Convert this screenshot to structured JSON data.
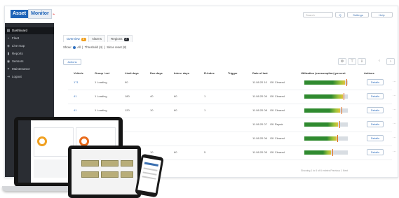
{
  "app": {
    "logo_part1": "Asset",
    "logo_part2": "Monitor",
    "search_placeholder": "Search",
    "top_buttons": [
      "Q",
      "Settings",
      "Help"
    ]
  },
  "sidebar": {
    "items": [
      {
        "label": "Dashboard",
        "icon": "grid-icon"
      },
      {
        "label": "Fleet",
        "icon": "truck-icon"
      },
      {
        "label": "Live map",
        "icon": "map-icon"
      },
      {
        "label": "Reports",
        "icon": "chart-icon"
      },
      {
        "label": "Sensors",
        "icon": "sensor-icon"
      },
      {
        "label": "Maintenance",
        "icon": "wrench-icon"
      },
      {
        "label": "Logout",
        "icon": "logout-icon"
      }
    ]
  },
  "tabs": [
    {
      "label": "Overview",
      "badge": "6",
      "badge_color": "#f0a020"
    },
    {
      "label": "Alarms",
      "badge": "",
      "badge_color": ""
    },
    {
      "label": "Regions",
      "badge": "2",
      "badge_color": "#2a2d33"
    }
  ],
  "filters": {
    "show_label": "Show:",
    "all_label": "All",
    "threshold_label": "Threshold (4)",
    "since_label": "Since reset (8)"
  },
  "toolbar": {
    "left_button": "Actions"
  },
  "table": {
    "columns": [
      "Vehicle",
      "Group / ext",
      "Limit days",
      "Due days",
      "Interv. days",
      "R-Index",
      "Trigger",
      "Date of last",
      "Utilization (consumption) percent",
      "Actions"
    ],
    "rows": [
      {
        "vehicle": "171",
        "group": "1 Loading",
        "limit": "90",
        "due": "",
        "interval": "",
        "rindex": "",
        "date": "11.08.20 10",
        "status": "OK Cleared",
        "fill": 0.93,
        "marker": 0.96,
        "action": "Details"
      },
      {
        "vehicle": "41",
        "group": "1 Loading",
        "limit": "180",
        "due": "40",
        "interval": "60",
        "rindex": "1",
        "date": "11.08.20 09",
        "status": "OK Cleared",
        "fill": 0.88,
        "marker": 0.9,
        "action": "Details"
      },
      {
        "vehicle": "41",
        "group": "1 Loading",
        "limit": "120",
        "due": "10",
        "interval": "60",
        "rindex": "1",
        "date": "11.08.20 08",
        "status": "OK Cleared",
        "fill": 0.82,
        "marker": 0.85,
        "action": "Details"
      },
      {
        "vehicle": "",
        "group": "",
        "limit": "",
        "due": "",
        "interval": "",
        "rindex": "",
        "date": "11.08.20 07",
        "status": "OK Repair",
        "fill": 0.78,
        "marker": 0.8,
        "action": "Details"
      },
      {
        "vehicle": "",
        "group": "",
        "limit": "",
        "due": "",
        "interval": "",
        "rindex": "",
        "date": "11.08.20 06",
        "status": "OK Cleared",
        "fill": 0.74,
        "marker": 0.76,
        "action": "Details"
      },
      {
        "vehicle": "",
        "group": "",
        "limit": "",
        "due": "10",
        "interval": "60",
        "rindex": "5",
        "date": "11.08.20 05",
        "status": "OK Cleared",
        "fill": 0.62,
        "marker": 0.65,
        "action": "Details"
      }
    ],
    "bar_colors": [
      "#2f8a2f",
      "#9bc23a",
      "#e0c23a"
    ]
  },
  "pager": "Showing 1 to 6 of 6 entries   Previous   1   Next"
}
